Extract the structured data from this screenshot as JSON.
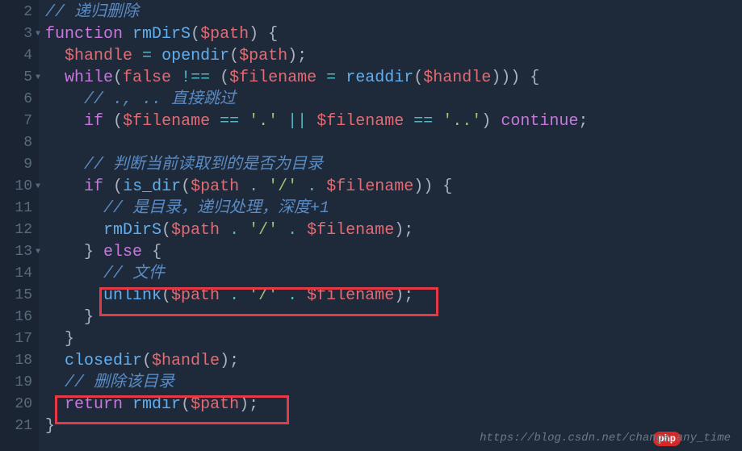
{
  "gutter": {
    "lines": [
      "2",
      "3",
      "4",
      "5",
      "6",
      "7",
      "8",
      "9",
      "10",
      "11",
      "12",
      "13",
      "14",
      "15",
      "16",
      "17",
      "18",
      "19",
      "20",
      "21"
    ],
    "fold_lines": [
      "3",
      "5",
      "10",
      "13"
    ]
  },
  "code": {
    "l2_comment": "// 递归删除",
    "l3_kw": "function",
    "l3_fn": "rmDirS",
    "l3_var": "$path",
    "l4_var1": "$handle",
    "l4_fn": "opendir",
    "l4_var2": "$path",
    "l5_kw": "while",
    "l5_false": "false",
    "l5_op": "!==",
    "l5_var1": "$filename",
    "l5_fn": "readdir",
    "l5_var2": "$handle",
    "l6_comment": "// ., .. 直接跳过",
    "l7_kw": "if",
    "l7_var1": "$filename",
    "l7_str1": "'.'",
    "l7_var2": "$filename",
    "l7_str2": "'..'",
    "l7_cont": "continue",
    "l9_comment": "// 判断当前读取到的是否为目录",
    "l10_kw": "if",
    "l10_fn": "is_dir",
    "l10_var1": "$path",
    "l10_str": "'/'",
    "l10_var2": "$filename",
    "l11_comment": "// 是目录，递归处理，深度+1",
    "l12_fn": "rmDirS",
    "l12_var1": "$path",
    "l12_str": "'/'",
    "l12_var2": "$filename",
    "l13_kw": "else",
    "l14_comment": "// 文件",
    "l15_fn": "unlink",
    "l15_var1": "$path",
    "l15_str": "'/'",
    "l15_var2": "$filename",
    "l18_fn": "closedir",
    "l18_var": "$handle",
    "l19_comment": "// 删除该目录",
    "l20_kw": "return",
    "l20_fn": "rmdir",
    "l20_var": "$path"
  },
  "watermark": "https://blog.csdn.net/change_any_time",
  "badge": "php"
}
